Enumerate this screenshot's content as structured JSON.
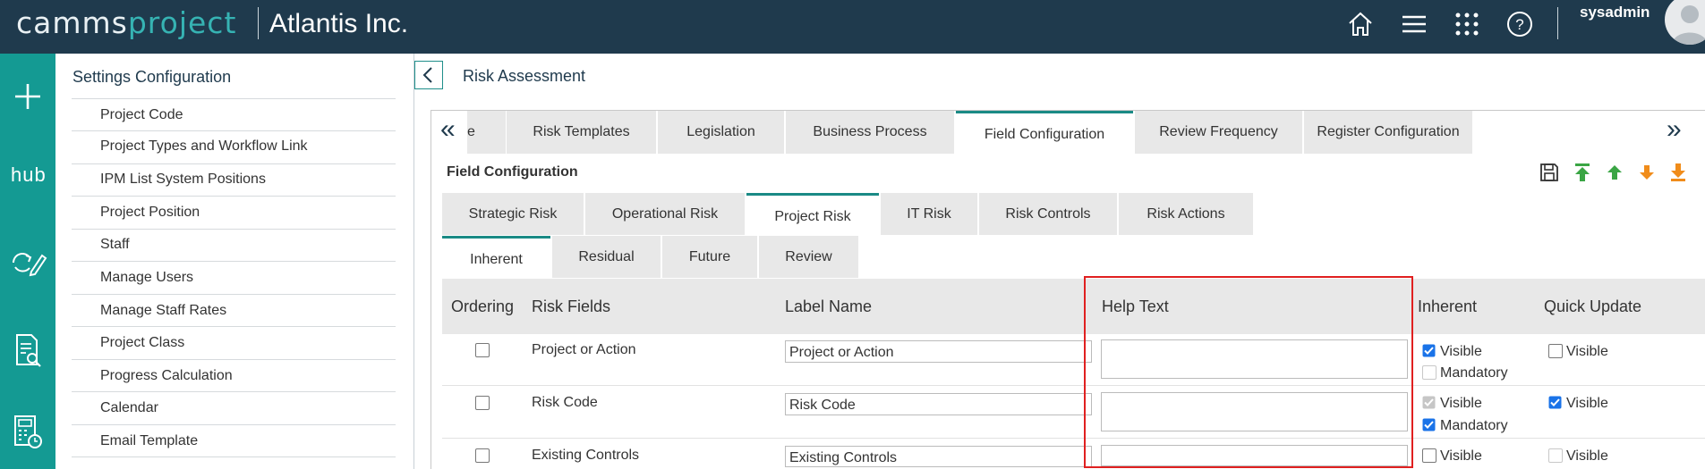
{
  "topbar": {
    "logo_main": "camms",
    "logo_accent": "project",
    "org_name": "Atlantis Inc.",
    "user_name": "sysadmin",
    "icons": [
      "home-icon",
      "menu-icon",
      "apps-grid-icon",
      "help-icon"
    ]
  },
  "rail": {
    "items": [
      {
        "icon": "plus-icon"
      },
      {
        "label": "hub",
        "icon": "hub-logo"
      },
      {
        "icon": "refresh-edit-icon"
      },
      {
        "icon": "document-search-icon"
      },
      {
        "icon": "calculator-clock-icon"
      }
    ]
  },
  "settings": {
    "title": "Settings Configuration",
    "items": [
      "Project Code",
      "Project Types and Workflow Link",
      "IPM List System Positions",
      "Project Position",
      "Staff",
      "Manage Users",
      "Manage Staff Rates",
      "Project Class",
      "Progress Calculation",
      "Calendar",
      "Email Template"
    ]
  },
  "main": {
    "title": "Risk Assessment",
    "tabs": [
      {
        "label": "e",
        "active": false
      },
      {
        "label": "Risk Templates",
        "active": false
      },
      {
        "label": "Legislation",
        "active": false
      },
      {
        "label": "Business Process",
        "active": false
      },
      {
        "label": "Field Configuration",
        "active": true
      },
      {
        "label": "Review Frequency",
        "active": false
      },
      {
        "label": "Register Configuration",
        "active": false
      }
    ],
    "section_title": "Field Configuration",
    "toolbar_icons": [
      "save-icon",
      "move-top-icon",
      "move-up-icon",
      "move-down-icon",
      "move-bottom-icon"
    ],
    "risk_tabs": [
      {
        "label": "Strategic Risk",
        "active": false
      },
      {
        "label": "Operational Risk",
        "active": false
      },
      {
        "label": "Project Risk",
        "active": true
      },
      {
        "label": "IT Risk",
        "active": false
      },
      {
        "label": "Risk Controls",
        "active": false
      },
      {
        "label": "Risk Actions",
        "active": false
      }
    ],
    "phase_tabs": [
      {
        "label": "Inherent",
        "active": true
      },
      {
        "label": "Residual",
        "active": false
      },
      {
        "label": "Future",
        "active": false
      },
      {
        "label": "Review",
        "active": false
      }
    ],
    "table": {
      "headers": [
        "Ordering",
        "Risk Fields",
        "Label Name",
        "Help Text",
        "Inherent",
        "Quick Update"
      ],
      "rows": [
        {
          "field": "Project or Action",
          "label": "Project or Action",
          "help": "",
          "inherent_visible": "Visible",
          "inherent_visible_checked": true,
          "inherent_visible_disabled": false,
          "inherent_mandatory": "Mandatory",
          "inherent_mandatory_checked": false,
          "inherent_mandatory_disabled": true,
          "qu_visible": "Visible",
          "qu_visible_checked": false,
          "qu_visible_disabled": false
        },
        {
          "field": "Risk Code",
          "label": "Risk Code",
          "help": "",
          "inherent_visible": "Visible",
          "inherent_visible_checked": true,
          "inherent_visible_disabled": true,
          "inherent_mandatory": "Mandatory",
          "inherent_mandatory_checked": true,
          "inherent_mandatory_disabled": false,
          "qu_visible": "Visible",
          "qu_visible_checked": true,
          "qu_visible_disabled": false
        },
        {
          "field": "Existing Controls",
          "label": "Existing Controls",
          "help": "",
          "inherent_visible": "Visible",
          "inherent_visible_checked": false,
          "inherent_visible_disabled": false,
          "qu_visible": "Visible",
          "qu_visible_checked": false,
          "qu_visible_disabled": true
        }
      ]
    }
  },
  "colors": {
    "topbar": "#1f3a4d",
    "rail": "#149a93",
    "accent": "#1a8a85",
    "highlight_box": "#e02020"
  }
}
